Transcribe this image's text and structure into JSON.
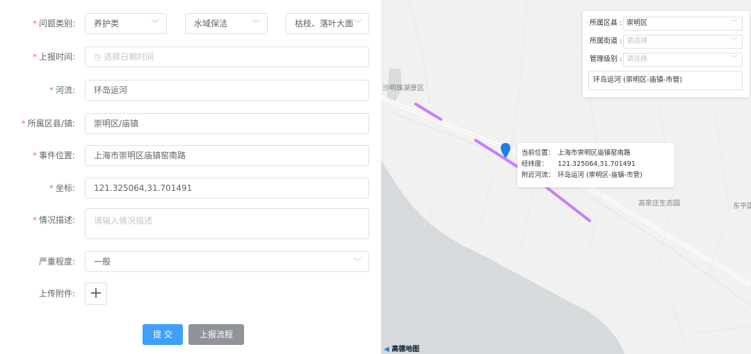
{
  "form": {
    "category": {
      "label": "问题类别:",
      "selects": [
        "养护类",
        "水域保洁",
        "枯枝、落叶大面"
      ]
    },
    "report_time": {
      "label": "上报时间:",
      "placeholder": "选择日期时间"
    },
    "river": {
      "label": "河流:",
      "value": "环岛运河"
    },
    "district": {
      "label": "所属区县/镇:",
      "value": "崇明区/庙镇"
    },
    "location": {
      "label": "事件位置:",
      "value": "上海市崇明区庙镇窑南路"
    },
    "coords": {
      "label": "坐标:",
      "value": "121.325064,31.701491"
    },
    "description": {
      "label": "情况描述:",
      "placeholder": "请输入情况描述"
    },
    "severity": {
      "label": "严重程度:",
      "value": "一般"
    },
    "attachment": {
      "label": "上传附件:"
    },
    "submit_label": "提 交",
    "flow_label": "上报流程"
  },
  "map": {
    "filter": {
      "district_label": "所属区县 :",
      "district_value": "崇明区",
      "street_label": "所属街道 :",
      "street_placeholder": "请选择",
      "level_label": "管理级别 :",
      "level_placeholder": "请选择",
      "river_value": "环岛运河 (崇明区-庙镇-市管)"
    },
    "popup": {
      "pos_label": "当前位置：",
      "pos_value": "上海市崇明区庙镇窑南路",
      "lnglat_label": "经纬度：",
      "lnglat_value": "121.325064,31.701491",
      "river_label": "附近河流：",
      "river_value": "环岛运河 (崇明区-庙镇-市管)"
    },
    "labels": {
      "scenic": "沙明珠湖景区",
      "park": "高家庄生态园",
      "east": "东平国"
    },
    "logo": "高德地图",
    "colors": {
      "river_highlight": "#c77dff",
      "pin": "#1e7fe8",
      "water": "#d6dadc"
    }
  }
}
